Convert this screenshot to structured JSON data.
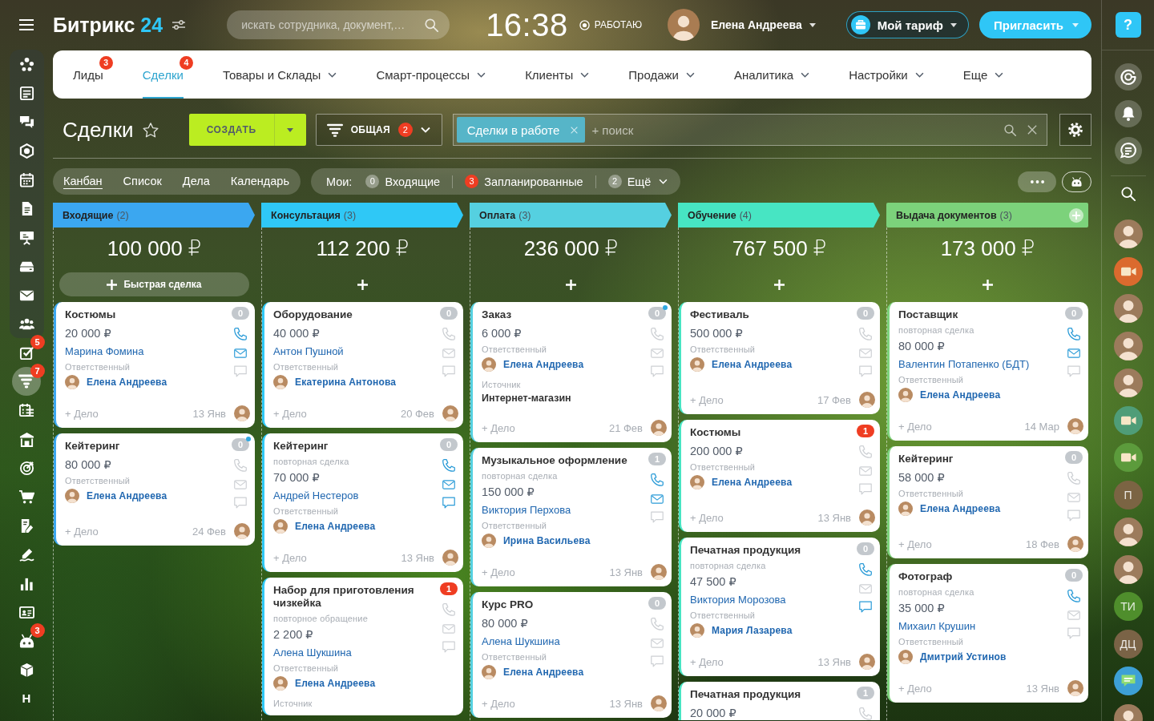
{
  "header": {
    "logo": {
      "text": "Битрикс",
      "number": "24"
    },
    "search": {
      "placeholder": "искать сотрудника, документ,…"
    },
    "clock": "16:38",
    "work_status": "РАБОТАЮ",
    "user": "Елена Андреева",
    "tariff": "Мой тариф",
    "invite": "Пригласить"
  },
  "left_sidebar": {
    "panel_items": [
      {
        "kind": "feed",
        "selected": false
      },
      {
        "kind": "news",
        "selected": false
      },
      {
        "kind": "chat",
        "selected": false
      },
      {
        "kind": "hexagon",
        "selected": false
      },
      {
        "kind": "calendar",
        "selected": false
      },
      {
        "kind": "document",
        "selected": false
      },
      {
        "kind": "presentation",
        "selected": false
      },
      {
        "kind": "drive",
        "selected": false
      },
      {
        "kind": "mail",
        "selected": false
      },
      {
        "kind": "people",
        "selected": false
      }
    ],
    "items": [
      {
        "kind": "tasks",
        "badge": "5",
        "selected": false
      },
      {
        "kind": "funnel",
        "badge": "7",
        "selected": true
      },
      {
        "kind": "booking",
        "selected": false
      },
      {
        "kind": "store",
        "selected": false
      },
      {
        "kind": "target",
        "selected": false
      },
      {
        "kind": "cart",
        "selected": false
      },
      {
        "kind": "sign",
        "selected": false
      },
      {
        "kind": "signature",
        "selected": false
      },
      {
        "kind": "chart",
        "selected": false
      },
      {
        "kind": "card",
        "selected": false
      },
      {
        "kind": "robot",
        "badge": "3",
        "selected": false
      },
      {
        "kind": "cube",
        "selected": false
      },
      {
        "kind": "letter",
        "label": "Н",
        "selected": false
      }
    ]
  },
  "nav": [
    {
      "label": "Лиды",
      "badge": "3",
      "dropdown": false,
      "selected": false
    },
    {
      "label": "Сделки",
      "badge": "4",
      "dropdown": false,
      "selected": true
    },
    {
      "label": "Товары и Склады",
      "dropdown": true,
      "selected": false
    },
    {
      "label": "Смарт-процессы",
      "dropdown": true,
      "selected": false
    },
    {
      "label": "Клиенты",
      "dropdown": true,
      "selected": false
    },
    {
      "label": "Продажи",
      "dropdown": true,
      "selected": false
    },
    {
      "label": "Аналитика",
      "dropdown": true,
      "selected": false
    },
    {
      "label": "Настройки",
      "dropdown": true,
      "selected": false
    },
    {
      "label": "Еще",
      "dropdown": true,
      "selected": false
    }
  ],
  "toolbar": {
    "title": "Сделки",
    "create": "СОЗДАТЬ",
    "category": {
      "label": "ОБЩАЯ",
      "badge": "2"
    },
    "filter": {
      "tag": "Сделки в работе",
      "placeholder": "+ поиск"
    }
  },
  "views": [
    {
      "label": "Канбан",
      "selected": true
    },
    {
      "label": "Список",
      "selected": false
    },
    {
      "label": "Дела",
      "selected": false
    },
    {
      "label": "Календарь",
      "selected": false
    }
  ],
  "counters": {
    "label": "Мои:",
    "items": [
      {
        "count": "0",
        "label": "Входящие",
        "alert": false,
        "dropdown": false
      },
      {
        "count": "3",
        "label": "Запланированные",
        "alert": true,
        "dropdown": false
      },
      {
        "count": "2",
        "label": "Ещё",
        "alert": false,
        "dropdown": true
      }
    ]
  },
  "columns": [
    {
      "title": "Входящие",
      "count": "(2)",
      "color": "#3ba7f0",
      "total": "100 000 ₽",
      "quick_add": "Быстрая сделка",
      "add_stage": false,
      "cards": [
        {
          "title": "Костюмы",
          "price": "20 000 ₽",
          "client": "Марина Фомина",
          "responsible_label": "Ответственный",
          "responsible": "Елена Андреева",
          "action": "+ Дело",
          "date": "13 Янв",
          "counter": "0",
          "counter_alert": false,
          "unread": false,
          "phone": true,
          "email": true,
          "chat": false
        },
        {
          "title": "Кейтеринг",
          "price": "80 000 ₽",
          "responsible_label": "Ответственный",
          "responsible": "Елена Андреева",
          "action": "+ Дело",
          "date": "24 Фев",
          "counter": "0",
          "counter_alert": false,
          "unread": true,
          "phone": false,
          "email": false,
          "chat": false
        }
      ]
    },
    {
      "title": "Консультация",
      "count": "(3)",
      "color": "#2fc8f6",
      "total": "112 200 ₽",
      "add_stage": false,
      "cards": [
        {
          "title": "Оборудование",
          "price": "40 000 ₽",
          "client": "Антон Пушной",
          "responsible_label": "Ответственный",
          "responsible": "Екатерина Антонова",
          "action": "+ Дело",
          "date": "20 Фев",
          "counter": "0",
          "counter_alert": false,
          "unread": false,
          "phone": false,
          "email": false,
          "chat": false
        },
        {
          "title": "Кейтеринг",
          "subtitle": "повторная сделка",
          "price": "70 000 ₽",
          "client": "Андрей Нестеров",
          "responsible_label": "Ответственный",
          "responsible": "Елена Андреева",
          "action": "+ Дело",
          "date": "13 Янв",
          "counter": "0",
          "counter_alert": false,
          "unread": false,
          "phone": true,
          "email": true,
          "chat": true
        },
        {
          "title": "Набор для приготовления чизкейка",
          "subtitle": "повторное обращение",
          "price": "2 200 ₽",
          "client": "Алена Шукшина",
          "responsible_label": "Ответственный",
          "responsible": "Елена Андреева",
          "source_label": "Источник",
          "counter": "1",
          "counter_alert": true,
          "unread": false,
          "phone": false,
          "email": false,
          "chat": false
        }
      ]
    },
    {
      "title": "Оплата",
      "count": "(3)",
      "color": "#55d0e0",
      "total": "236 000 ₽",
      "add_stage": false,
      "cards": [
        {
          "title": "Заказ",
          "price": "6 000 ₽",
          "responsible_label": "Ответственный",
          "responsible": "Елена Андреева",
          "source_label": "Источник",
          "source": "Интернет-магазин",
          "action": "+ Дело",
          "date": "21 Фев",
          "counter": "0",
          "counter_alert": false,
          "unread": true,
          "phone": false,
          "email": false,
          "chat": false
        },
        {
          "title": "Музыкальное оформление",
          "subtitle": "повторная сделка",
          "price": "150 000 ₽",
          "client": "Виктория Перхова",
          "responsible_label": "Ответственный",
          "responsible": "Ирина Васильева",
          "action": "+ Дело",
          "date": "13 Янв",
          "counter": "1",
          "counter_alert": false,
          "unread": false,
          "phone": true,
          "email": true,
          "chat": false
        },
        {
          "title": "Курс PRO",
          "price": "80 000 ₽",
          "client": "Алена Шукшина",
          "responsible_label": "Ответственный",
          "responsible": "Елена Андреева",
          "action": "+ Дело",
          "date": "13 Янв",
          "counter": "0",
          "counter_alert": false,
          "unread": false,
          "phone": false,
          "email": false,
          "chat": false
        }
      ]
    },
    {
      "title": "Обучение",
      "count": "(4)",
      "color": "#47e5c3",
      "total": "767 500 ₽",
      "add_stage": false,
      "cards": [
        {
          "title": "Фестиваль",
          "price": "500 000 ₽",
          "responsible_label": "Ответственный",
          "responsible": "Елена Андреева",
          "action": "+ Дело",
          "date": "17 Фев",
          "counter": "0",
          "counter_alert": false,
          "unread": false,
          "phone": false,
          "email": false,
          "chat": false
        },
        {
          "title": "Костюмы",
          "price": "200 000 ₽",
          "responsible_label": "Ответственный",
          "responsible": "Елена Андреева",
          "action": "+ Дело",
          "date": "13 Янв",
          "counter": "1",
          "counter_alert": true,
          "unread": false,
          "phone": false,
          "email": false,
          "chat": false
        },
        {
          "title": "Печатная продукция",
          "subtitle": "повторная сделка",
          "price": "47 500 ₽",
          "client": "Виктория Морозова",
          "responsible_label": "Ответственный",
          "responsible": "Мария Лазарева",
          "action": "+ Дело",
          "date": "13 Янв",
          "counter": "0",
          "counter_alert": false,
          "unread": false,
          "phone": true,
          "email": false,
          "chat": true
        },
        {
          "title": "Печатная продукция",
          "price": "20 000 ₽",
          "counter": "1",
          "counter_alert": false,
          "unread": false,
          "phone": false
        }
      ]
    },
    {
      "title": "Выдача документов",
      "count": "(3)",
      "color": "#7cd27b",
      "total": "173 000 ₽",
      "add_stage": true,
      "cards": [
        {
          "title": "Поставщик",
          "subtitle": "повторная сделка",
          "price": "80 000 ₽",
          "client": "Валентин Потапенко (БДТ)",
          "responsible_label": "Ответственный",
          "responsible": "Елена Андреева",
          "action": "+ Дело",
          "date": "14 Мар",
          "counter": "0",
          "counter_alert": false,
          "unread": false,
          "phone": true,
          "email": true,
          "chat": false
        },
        {
          "title": "Кейтеринг",
          "price": "58 000 ₽",
          "responsible_label": "Ответственный",
          "responsible": "Елена Андреева",
          "action": "+ Дело",
          "date": "18 Фев",
          "counter": "0",
          "counter_alert": false,
          "unread": false,
          "phone": false,
          "email": false,
          "chat": false
        },
        {
          "title": "Фотограф",
          "subtitle": "повторная сделка",
          "price": "35 000 ₽",
          "client": "Михаил Крушин",
          "responsible_label": "Ответственный",
          "responsible": "Дмитрий Устинов",
          "action": "+ Дело",
          "date": "13 Янв",
          "counter": "0",
          "counter_alert": false,
          "unread": false,
          "phone": true,
          "email": false,
          "chat": false
        }
      ]
    }
  ],
  "right_sidebar": {
    "help": "?",
    "tools": [
      {
        "kind": "copilot"
      },
      {
        "kind": "bell"
      },
      {
        "kind": "messages"
      },
      {
        "kind": "search"
      }
    ],
    "contacts": [
      {
        "kind": "photo"
      },
      {
        "kind": "video",
        "color": "#db6a2e"
      },
      {
        "kind": "photo"
      },
      {
        "kind": "photo"
      },
      {
        "kind": "photo"
      },
      {
        "kind": "video",
        "color": "#4f9d78"
      },
      {
        "kind": "video",
        "color": "#5c9b3c"
      },
      {
        "kind": "initials",
        "label": "П",
        "color": "#7b6443"
      },
      {
        "kind": "photo"
      },
      {
        "kind": "photo"
      },
      {
        "kind": "initials",
        "label": "ТИ",
        "color": "#4f8e2c"
      },
      {
        "kind": "initials",
        "label": "ДЦ",
        "color": "#7a6346"
      },
      {
        "kind": "chat",
        "color": "#3da0d6"
      },
      {
        "kind": "photo"
      }
    ]
  }
}
